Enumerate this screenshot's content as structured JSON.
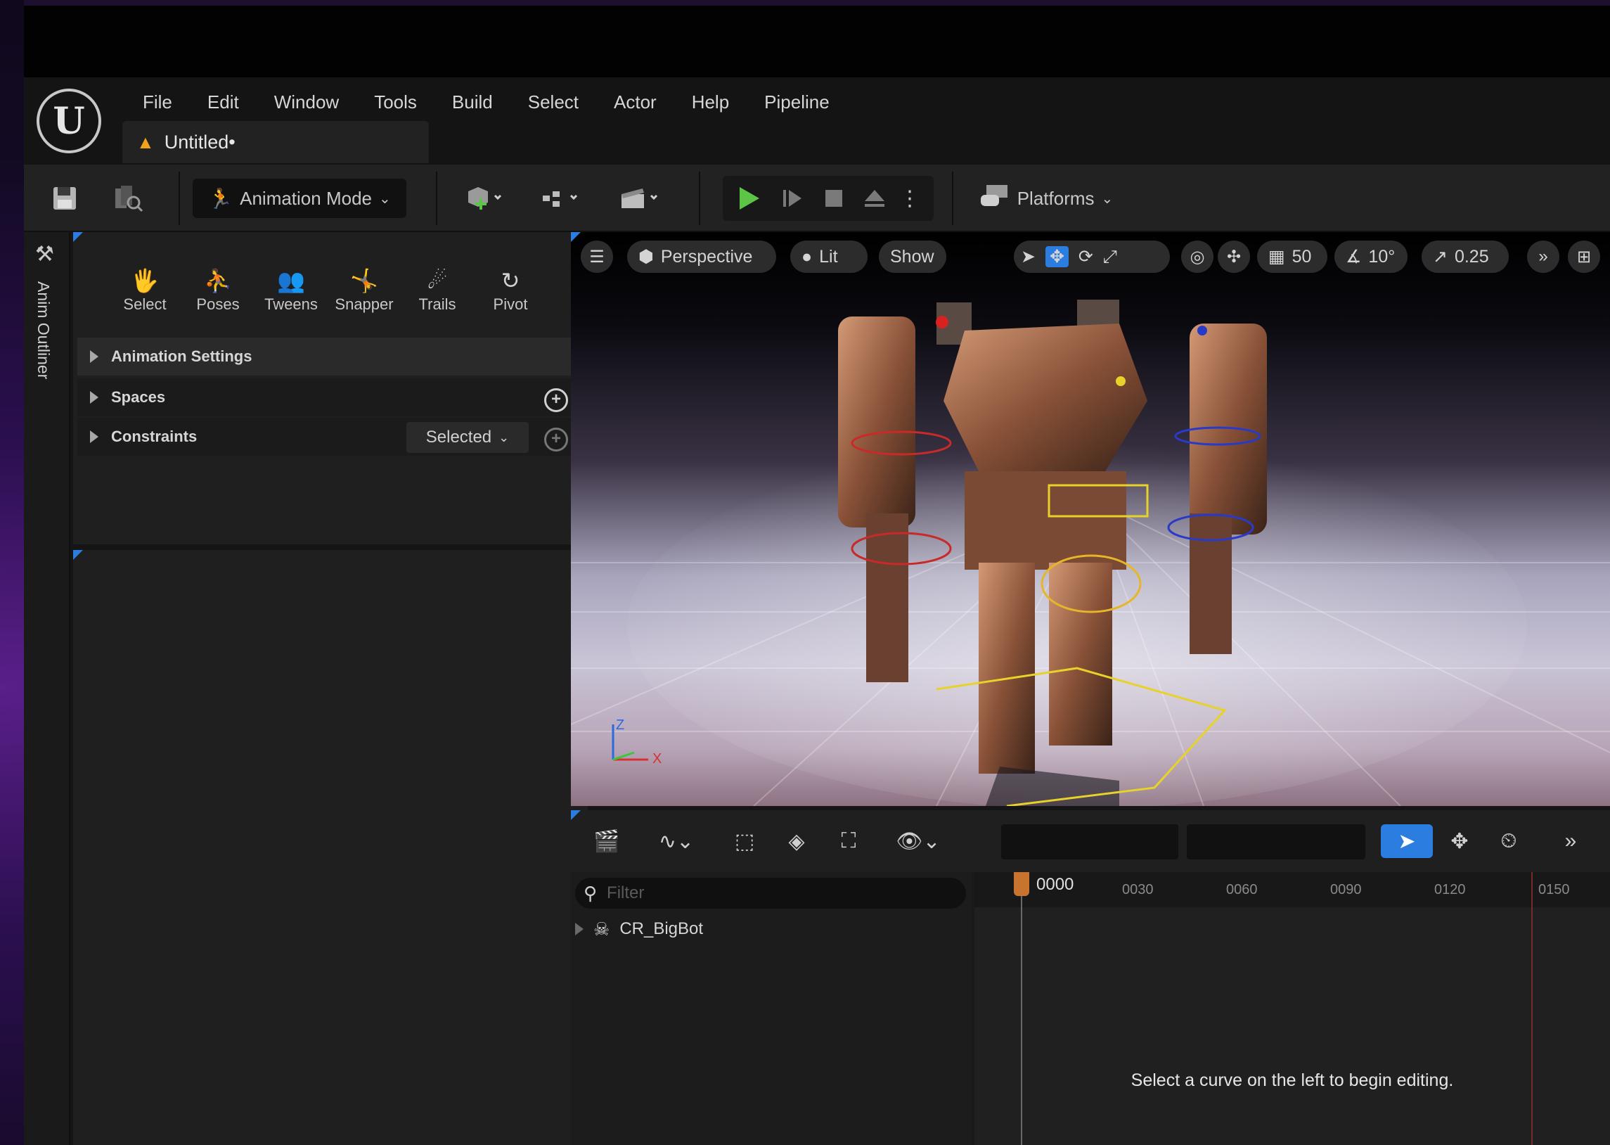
{
  "menu": {
    "items": [
      "File",
      "Edit",
      "Window",
      "Tools",
      "Build",
      "Select",
      "Actor",
      "Help",
      "Pipeline"
    ]
  },
  "document_tab": {
    "title": "Untitled•"
  },
  "toolbar": {
    "mode_label": "Animation Mode",
    "platforms_label": "Platforms"
  },
  "side_strip": {
    "label": "Anim Outliner"
  },
  "anim_tools": {
    "tabs": [
      "Select",
      "Poses",
      "Tweens",
      "Snapper",
      "Trails",
      "Pivot"
    ]
  },
  "anim_sections": {
    "animation_settings": "Animation Settings",
    "spaces": "Spaces",
    "constraints": "Constraints",
    "constraints_filter": "Selected"
  },
  "viewport": {
    "perspective_label": "Perspective",
    "lit_label": "Lit",
    "show_label": "Show",
    "grid_snap": "50",
    "rotation_snap": "10°",
    "scale_snap": "0.25",
    "axis_z": "Z",
    "axis_x": "X"
  },
  "sequencer": {
    "filter_placeholder": "Filter",
    "track_name": "CR_BigBot",
    "playhead_frame": "0000",
    "ticks": [
      "0030",
      "0060",
      "0090",
      "0120",
      "0150"
    ],
    "empty_message": "Select a curve on the left to begin editing."
  },
  "colors": {
    "accent_blue": "#2b7de0",
    "play_green": "#5cc447",
    "playhead_orange": "#c9742e",
    "warning_orange": "#f0a21a"
  }
}
